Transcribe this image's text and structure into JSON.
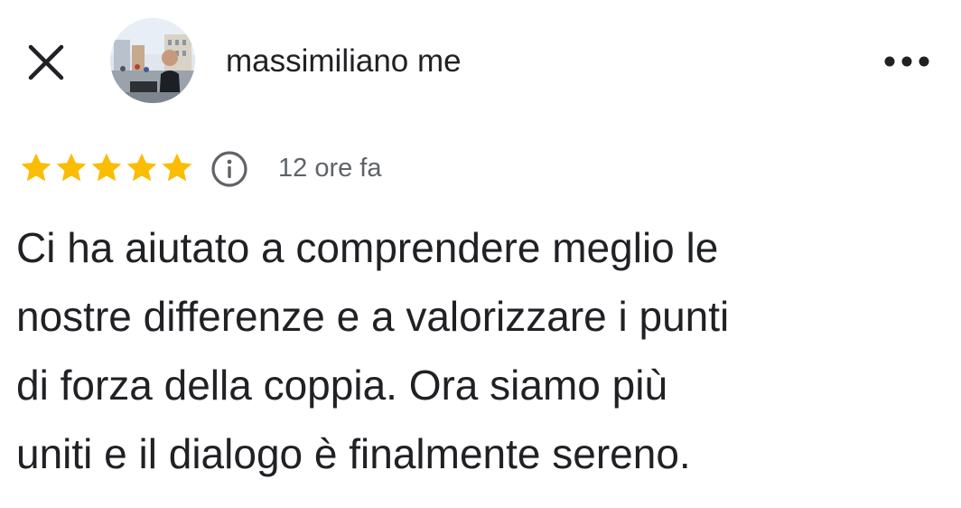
{
  "header": {
    "author_name": "massimiliano me",
    "close_icon": "close-icon",
    "more_icon": "more-horizontal-icon",
    "avatar": "profile-photo"
  },
  "review": {
    "rating": 5,
    "rating_max": 5,
    "star_color": "#fbbc04",
    "info_icon": "info-icon",
    "time_ago": "12 ore fa",
    "text": "Ci ha aiutato a comprendere meglio le\nnostre differenze e a valorizzare i punti\ndi forza della coppia. Ora siamo più\nuniti e il dialogo è finalmente sereno."
  }
}
